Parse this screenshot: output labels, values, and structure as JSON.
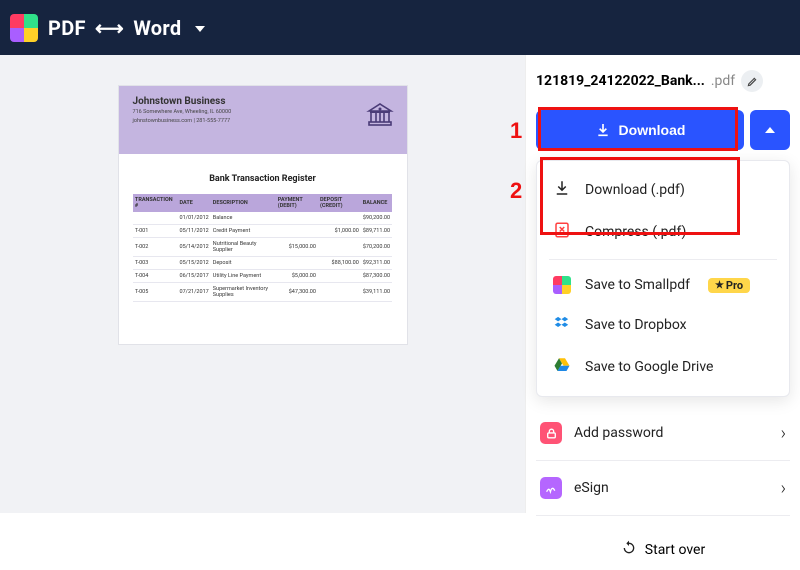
{
  "topbar": {
    "title_left": "PDF",
    "title_arrow": "⟷",
    "title_right": "Word"
  },
  "file": {
    "name_truncated": "121819_24122022_Bank...",
    "ext": ".pdf"
  },
  "download": {
    "button_label": "Download",
    "menu": [
      {
        "label": "Download (.pdf)"
      },
      {
        "label": "Compress (.pdf)"
      },
      {
        "label": "Save to Smallpdf",
        "pro": true,
        "pro_label": "Pro"
      },
      {
        "label": "Save to Dropbox"
      },
      {
        "label": "Save to Google Drive"
      }
    ]
  },
  "actions": {
    "add_password": "Add password",
    "esign": "eSign",
    "start_over": "Start over"
  },
  "annotations": {
    "one": "1",
    "two": "2"
  },
  "preview_doc": {
    "business_name": "Johnstown Business",
    "address_line1": "716 Somewhere Ave, Wheeling, IL 60000",
    "address_line2": "johnstownbusiness.com | 281-555-7777",
    "page_title": "Bank Transaction Register",
    "columns": [
      "TRANSACTION #",
      "DATE",
      "DESCRIPTION",
      "PAYMENT (DEBIT)",
      "DEPOSIT (CREDIT)",
      "BALANCE"
    ],
    "rows": [
      [
        "",
        "01/01/2012",
        "Balance",
        "",
        "",
        "$90,200.00"
      ],
      [
        "T-001",
        "05/11/2012",
        "Credit Payment",
        "",
        "$1,000.00",
        "$89,711.00"
      ],
      [
        "T-002",
        "05/14/2012",
        "Nutritional Beauty Supplier",
        "$15,000.00",
        "",
        "$70,200.00"
      ],
      [
        "T-003",
        "05/15/2012",
        "Deposit",
        "",
        "$88,100.00",
        "$92,311.00"
      ],
      [
        "T-004",
        "06/15/2017",
        "Utility Line Payment",
        "$5,000.00",
        "",
        "$87,300.00"
      ],
      [
        "T-005",
        "07/21/2017",
        "Supermarket Inventory Supplies",
        "$47,300.00",
        "",
        "$39,111.00"
      ]
    ]
  }
}
